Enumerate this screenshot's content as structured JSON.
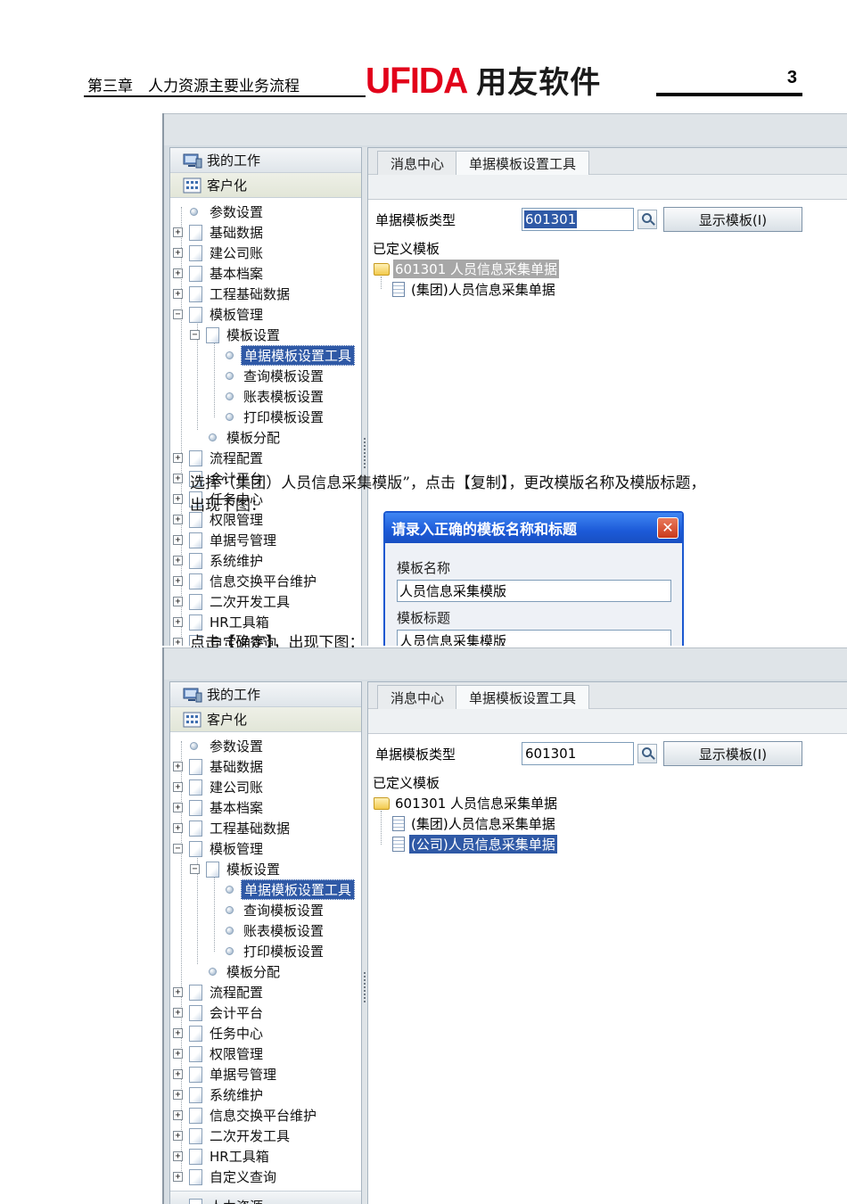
{
  "doc_header": {
    "chapter": "第三章　人力资源主要业务流程",
    "logo_text_latin": "UFIDA",
    "logo_text_cn": "用友软件",
    "page_number": "3"
  },
  "app": {
    "nav_header_my_work": "我的工作",
    "nav_header_customize": "客户化",
    "tabs": [
      "消息中心",
      "单据模板设置工具"
    ],
    "form": {
      "template_type_label": "单据模板类型",
      "template_type_value": "601301",
      "show_template_button": "显示模板(I)",
      "defined_templates_label": "已定义模板"
    }
  },
  "tree_items": {
    "param_settings": "参数设置",
    "basic_data": "基础数据",
    "create_account": "建公司账",
    "basic_archive": "基本档案",
    "engineering_data": "工程基础数据",
    "template_mgmt": "模板管理",
    "template_settings": "模板设置",
    "voucher_template_tool": "单据模板设置工具",
    "query_template": "查询模板设置",
    "report_template": "账表模板设置",
    "print_template": "打印模板设置",
    "template_assign": "模板分配",
    "process_config": "流程配置",
    "accounting_platform": "会计平台",
    "task_center": "任务中心",
    "permission_mgmt": "权限管理",
    "voucher_no_mgmt": "单据号管理",
    "system_maint": "系统维护",
    "info_exchange": "信息交换平台维护",
    "secondary_dev": "二次开发工具",
    "hr_toolbox": "HR工具箱",
    "custom_query": "自定义查询",
    "human_resources": "人力资源"
  },
  "template_tree": {
    "root": "601301 人员信息采集单据",
    "group_child": "(集团)人员信息采集单据",
    "company_child": "(公司)人员信息采集单据"
  },
  "dialog": {
    "title": "请录入正确的模板名称和标题",
    "close_glyph": "✕",
    "name_label": "模板名称",
    "name_value": "人员信息采集模版",
    "title_label": "模板标题",
    "title_value": "人员信息采集模版"
  },
  "doc_text": {
    "line1": "选择“（集团）人员信息采集模版”，点击【复制】，更改模版名称及模版标题，",
    "line2": "出现下图：",
    "line3": "点击【确定】，出现下图："
  },
  "colors": {
    "brand_red": "#e2001a",
    "selection_blue": "#2f59a6",
    "dialog_title_blue": "#1c5ad8"
  },
  "icons": {
    "nav_my_work": "monitor-icon",
    "nav_customize": "grid-icon",
    "tree_node": "page-icon",
    "tree_leaf": "bullet-icon",
    "search": "search-icon",
    "folder": "folder-icon",
    "template_doc": "document-icon",
    "dialog_close": "close-icon"
  }
}
